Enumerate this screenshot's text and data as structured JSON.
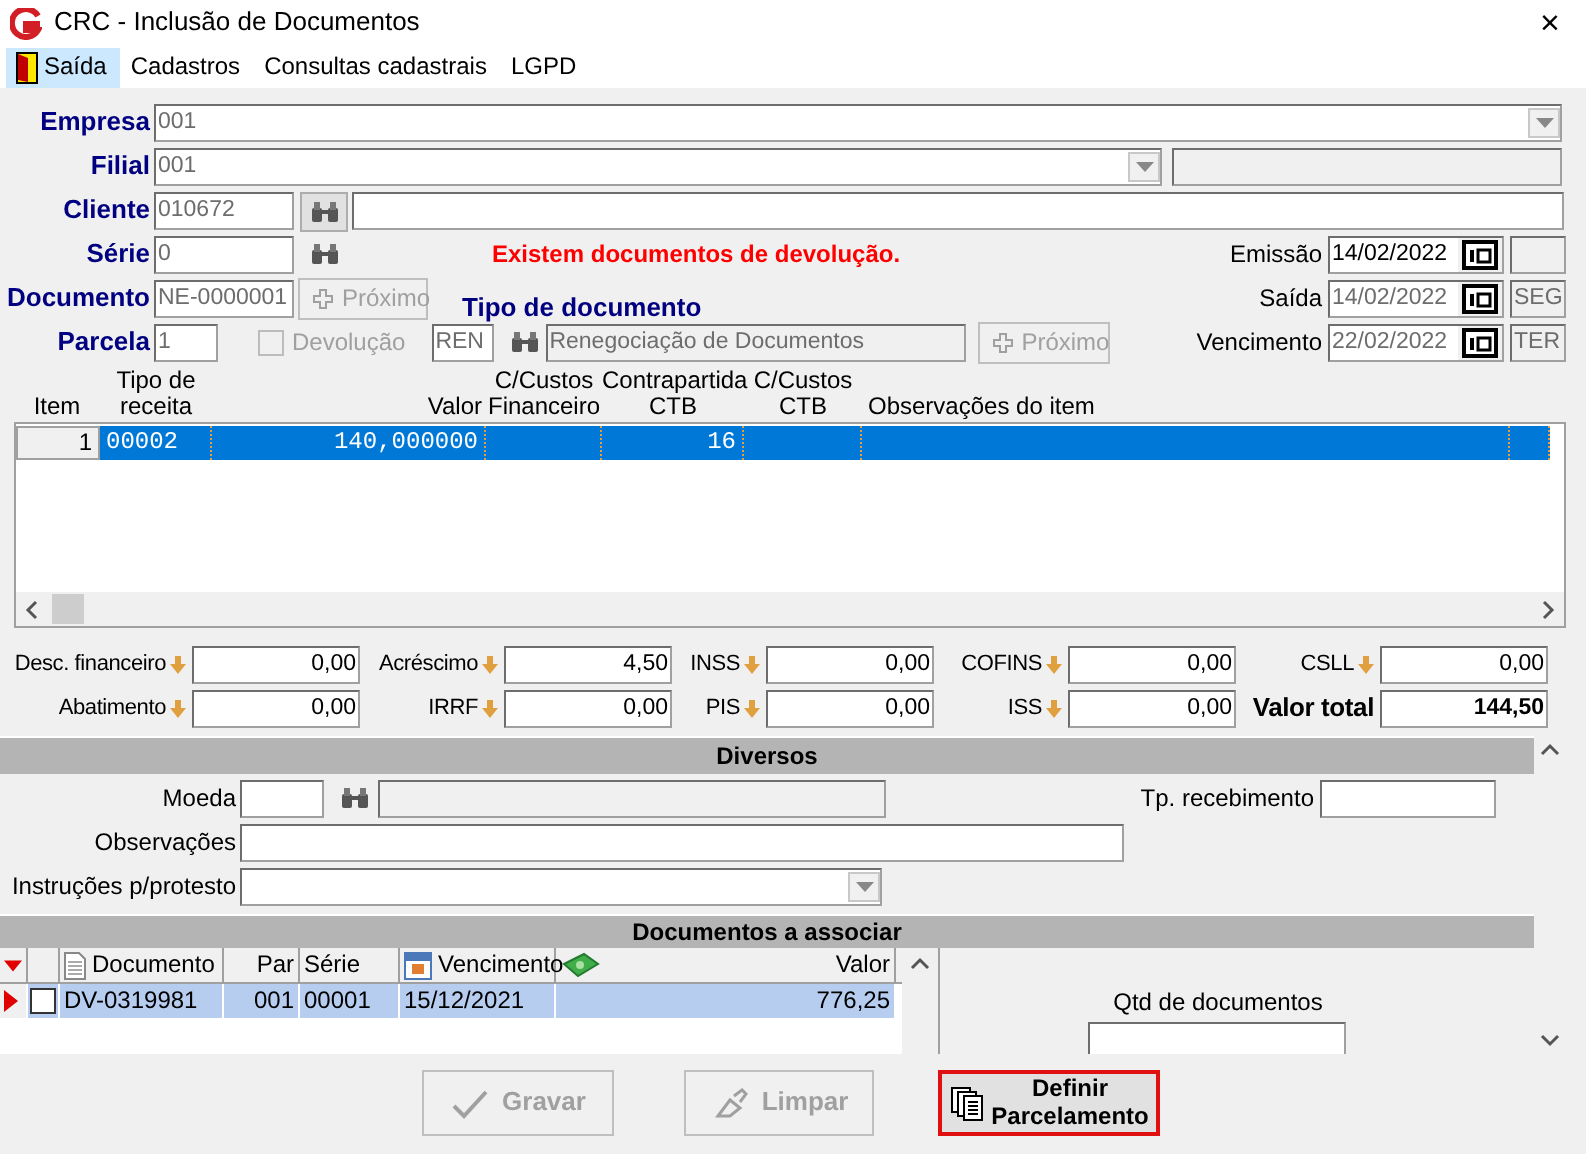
{
  "window": {
    "title": "CRC - Inclusão de Documentos",
    "close": "×"
  },
  "menu": [
    {
      "label": "Saída",
      "selected": true,
      "kind": "icon"
    },
    {
      "label": "Cadastros",
      "selected": false,
      "kind": "plain"
    },
    {
      "label": "Consultas cadastrais",
      "selected": false,
      "kind": "plain"
    },
    {
      "label": "LGPD",
      "selected": false,
      "kind": "plain"
    }
  ],
  "empresa": {
    "label": "Empresa",
    "value": "001"
  },
  "filial": {
    "label": "Filial",
    "value": "001"
  },
  "cliente": {
    "label": "Cliente",
    "value": "010672"
  },
  "serie": {
    "label": "Série",
    "value": "0"
  },
  "alert": "Existem documentos de devolução.",
  "documento": {
    "label": "Documento",
    "value": "NE-0000001",
    "next_button": {
      "label": "Próximo",
      "disabled": true
    }
  },
  "parcela": {
    "label": "Parcela",
    "value": "1"
  },
  "devolucao": {
    "label": "Devolução",
    "checked": false,
    "disabled": true
  },
  "tipo_documento": {
    "label": "Tipo de documento",
    "code": "REN",
    "description": "Renegociação de Documentos",
    "next_button": {
      "label": "Próximo",
      "disabled": true
    }
  },
  "dates": [
    {
      "label": "Emissão",
      "value": "14/02/2022",
      "disabled": false
    },
    {
      "label": "Saída",
      "value": "14/02/2022",
      "disabled": true,
      "weekday": "SEG"
    },
    {
      "label": "Vencimento",
      "value": "22/02/2022",
      "disabled": true,
      "weekday": "TER"
    }
  ],
  "items_grid": {
    "columns": [
      {
        "label": "Item"
      },
      {
        "label": "Tipo de\nreceita"
      },
      {
        "label": "Valor"
      },
      {
        "label": "C/Custos\nFinanceiro"
      },
      {
        "label": "Contrapartida\nCTB"
      },
      {
        "label": "C/Custos\nCTB"
      },
      {
        "label": "Observações do item"
      }
    ],
    "rows": [
      {
        "selected": true,
        "item": "1",
        "tipo_de_receita": "00002",
        "valor": "140,000000",
        "contrapartida_ctb": "16"
      }
    ]
  },
  "totals": [
    {
      "label": "Desc. financeiro",
      "value": "0,00",
      "kind": "adjust"
    },
    {
      "label": "Acréscimo",
      "value": "4,50",
      "kind": "adjust"
    },
    {
      "label": "INSS",
      "value": "0,00",
      "kind": "adjust"
    },
    {
      "label": "COFINS",
      "value": "0,00",
      "kind": "adjust"
    },
    {
      "label": "CSLL",
      "value": "0,00",
      "kind": "adjust"
    },
    {
      "label": "Abatimento",
      "value": "0,00",
      "kind": "adjust"
    },
    {
      "label": "IRRF",
      "value": "0,00",
      "kind": "adjust"
    },
    {
      "label": "PIS",
      "value": "0,00",
      "kind": "adjust"
    },
    {
      "label": "ISS",
      "value": "0,00",
      "kind": "adjust"
    },
    {
      "label": "Valor total",
      "value": "144,50",
      "kind": "total"
    }
  ],
  "diversos": {
    "title": "Diversos",
    "moeda": {
      "label": "Moeda"
    },
    "tp_recebimento": {
      "label": "Tp. recebimento"
    },
    "observacoes": {
      "label": "Observações"
    },
    "instrucoes": {
      "label": "Instruções p/protesto"
    }
  },
  "documentos": {
    "title": "Documentos a associar",
    "columns": [
      {
        "label": "Documento",
        "kind": "document"
      },
      {
        "label": "Par",
        "kind": "plain"
      },
      {
        "label": "Série",
        "kind": "plain"
      },
      {
        "label": "Vencimento",
        "kind": "date"
      },
      {
        "label": "Valor",
        "kind": "money"
      }
    ],
    "rows": [
      {
        "selected": true,
        "checked": false,
        "documento": "DV-0319981",
        "par": "001",
        "serie": "00001",
        "vencimento": "15/12/2021",
        "valor": "776,25"
      }
    ],
    "qtd_label": "Qtd de documentos"
  },
  "buttons": [
    {
      "label": "Gravar",
      "kind": "save",
      "disabled": true,
      "highlighted": false
    },
    {
      "label": "Limpar",
      "kind": "clear",
      "disabled": true,
      "highlighted": false
    },
    {
      "label": "Definir\nParcelamento",
      "kind": "installments",
      "disabled": false,
      "highlighted": true
    }
  ]
}
